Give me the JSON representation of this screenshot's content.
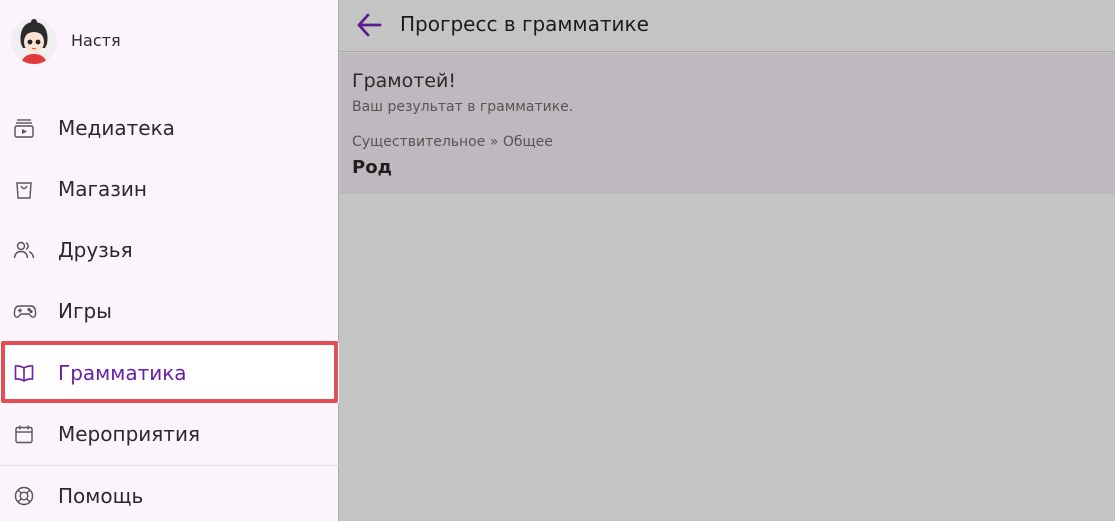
{
  "profile": {
    "name": "Настя",
    "avatar_icon": "girl-avatar"
  },
  "sidebar": {
    "items": [
      {
        "label": "Медиатека",
        "icon": "media-library-icon"
      },
      {
        "label": "Магазин",
        "icon": "shopping-bag-icon"
      },
      {
        "label": "Друзья",
        "icon": "friends-icon"
      },
      {
        "label": "Игры",
        "icon": "gamepad-icon"
      },
      {
        "label": "Грамматика",
        "icon": "book-icon",
        "active": true
      },
      {
        "label": "Мероприятия",
        "icon": "calendar-icon"
      },
      {
        "label": "Помощь",
        "icon": "lifebuoy-icon"
      }
    ]
  },
  "header": {
    "title": "Прогресс в грамматике",
    "back_icon": "arrow-left-icon"
  },
  "card": {
    "title": "Грамотей!",
    "subtitle": "Ваш результат в грамматике.",
    "breadcrumb": "Существительное » Общее",
    "topic": "Род"
  },
  "colors": {
    "accent": "#6a1fa8",
    "highlight": "#e44d53",
    "sidebar_bg": "#fcf4fc",
    "overlay": "#c4c4c4"
  }
}
